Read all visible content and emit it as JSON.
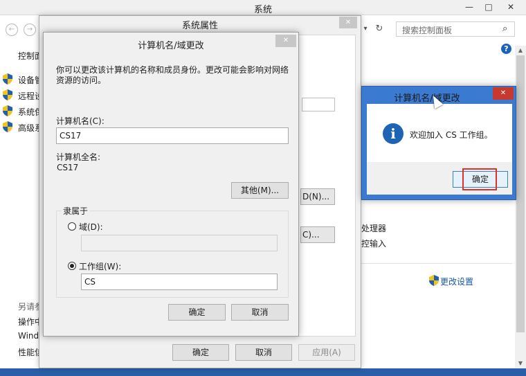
{
  "control_panel": {
    "title": "系统",
    "window_buttons": {
      "minimize": "—",
      "maximize": "□",
      "close": "✕"
    },
    "nav": {
      "back": "←",
      "forward": "→",
      "dropdown": "▾",
      "refresh": "↻"
    },
    "search": {
      "placeholder": "搜索控制面板",
      "icon": "⌕"
    },
    "help": "?",
    "left_header": "控制面",
    "sidebar_items": [
      {
        "label": "设备管"
      },
      {
        "label": "远程设"
      },
      {
        "label": "系统保"
      },
      {
        "label": "高级系"
      }
    ],
    "see_also": "另请参",
    "see_also_items": [
      "操作中",
      "Windo",
      "性能信"
    ],
    "content": {
      "processor_text": "处理器",
      "pen_text": "控输入",
      "change_settings": "更改设置"
    },
    "scroll": {
      "up": "▲",
      "down": "▼"
    }
  },
  "system_properties": {
    "title": "系统属性",
    "close": "✕",
    "ghost_buttons": [
      "D(N)...",
      "C)..."
    ],
    "buttons": {
      "ok": "确定",
      "cancel": "取消",
      "apply": "应用(A)"
    }
  },
  "computer_name_dialog": {
    "title": "计算机名/域更改",
    "close": "✕",
    "description": "你可以更改该计算机的名称和成员身份。更改可能会影响对网络资源的访问。",
    "name_label": "计算机名(C):",
    "name_value": "CS17",
    "full_name_label": "计算机全名:",
    "full_name_value": "CS17",
    "other_button": "其他(M)...",
    "member_of_label": "隶属于",
    "domain_label": "域(D):",
    "domain_value": "",
    "workgroup_label": "工作组(W):",
    "workgroup_value": "CS",
    "selected": "workgroup",
    "buttons": {
      "ok": "确定",
      "cancel": "取消"
    }
  },
  "welcome_dialog": {
    "title": "计算机名/域更改",
    "close": "✕",
    "icon": "i",
    "message": "欢迎加入 CS 工作组。",
    "ok": "确定"
  },
  "colors": {
    "accent_blue": "#3b7ad1",
    "close_red": "#c7382e",
    "highlight_red": "#e0302a",
    "link_blue": "#1a56a8"
  }
}
